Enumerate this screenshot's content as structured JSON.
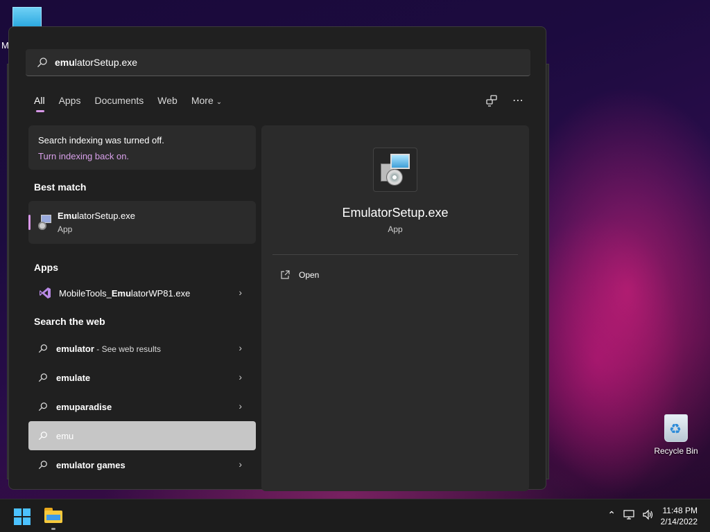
{
  "desktop": {
    "partial_label": "M",
    "recycle_bin_label": "Recycle Bin"
  },
  "search": {
    "query_typed": "emu",
    "query_rest": "latorSetup.exe",
    "icon": "search-icon"
  },
  "tabs": [
    {
      "label": "All",
      "active": true
    },
    {
      "label": "Apps"
    },
    {
      "label": "Documents"
    },
    {
      "label": "Web"
    },
    {
      "label": "More"
    }
  ],
  "tab_icons": [
    "share-icon",
    "more-options-icon"
  ],
  "notice": {
    "line1": "Search indexing was turned off.",
    "link": "Turn indexing back on."
  },
  "best_match": {
    "heading": "Best match",
    "name_bold": "Emu",
    "name_rest": "latorSetup.exe",
    "type": "App"
  },
  "apps": {
    "heading": "Apps",
    "items": [
      {
        "pre": "MobileTools_",
        "bold": "Emu",
        "post": "latorWP81.exe"
      }
    ]
  },
  "web": {
    "heading": "Search the web",
    "items": [
      {
        "text": "emulator",
        "hint": " - See web results"
      },
      {
        "text": "emulate",
        "hint": ""
      },
      {
        "text": "emuparadise",
        "hint": ""
      },
      {
        "text": "emu",
        "hint": "",
        "selected": true
      },
      {
        "text": "emulator games",
        "hint": ""
      }
    ]
  },
  "preview": {
    "title": "EmulatorSetup.exe",
    "kind": "App",
    "actions": [
      {
        "label": "Open",
        "icon": "open-icon"
      }
    ]
  },
  "taskbar": {
    "time": "11:48 PM",
    "date": "2/14/2022",
    "accent": "#4cc2ff"
  }
}
